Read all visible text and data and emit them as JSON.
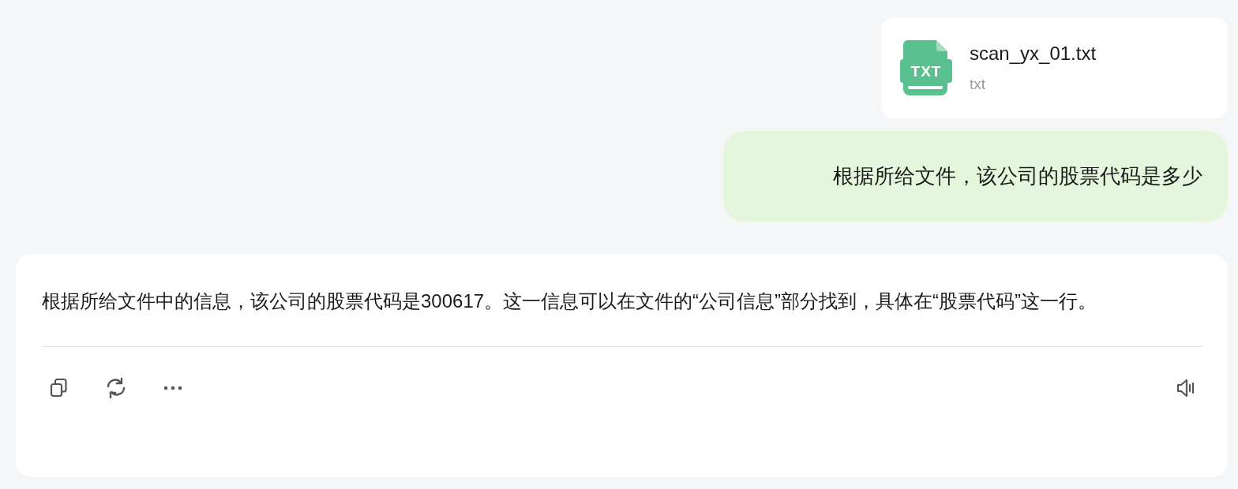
{
  "attachment": {
    "filename": "scan_yx_01.txt",
    "type_label": "txt",
    "icon_text": "TXT"
  },
  "user_message": "根据所给文件，该公司的股票代码是多少",
  "answer": {
    "text": "根据所给文件中的信息，该公司的股票代码是300617。这一信息可以在文件的“公司信息”部分找到，具体在“股票代码”这一行。",
    "actions": [
      {
        "kind": "copy"
      },
      {
        "kind": "regenerate"
      },
      {
        "kind": "more"
      },
      {
        "kind": "speak"
      }
    ]
  }
}
